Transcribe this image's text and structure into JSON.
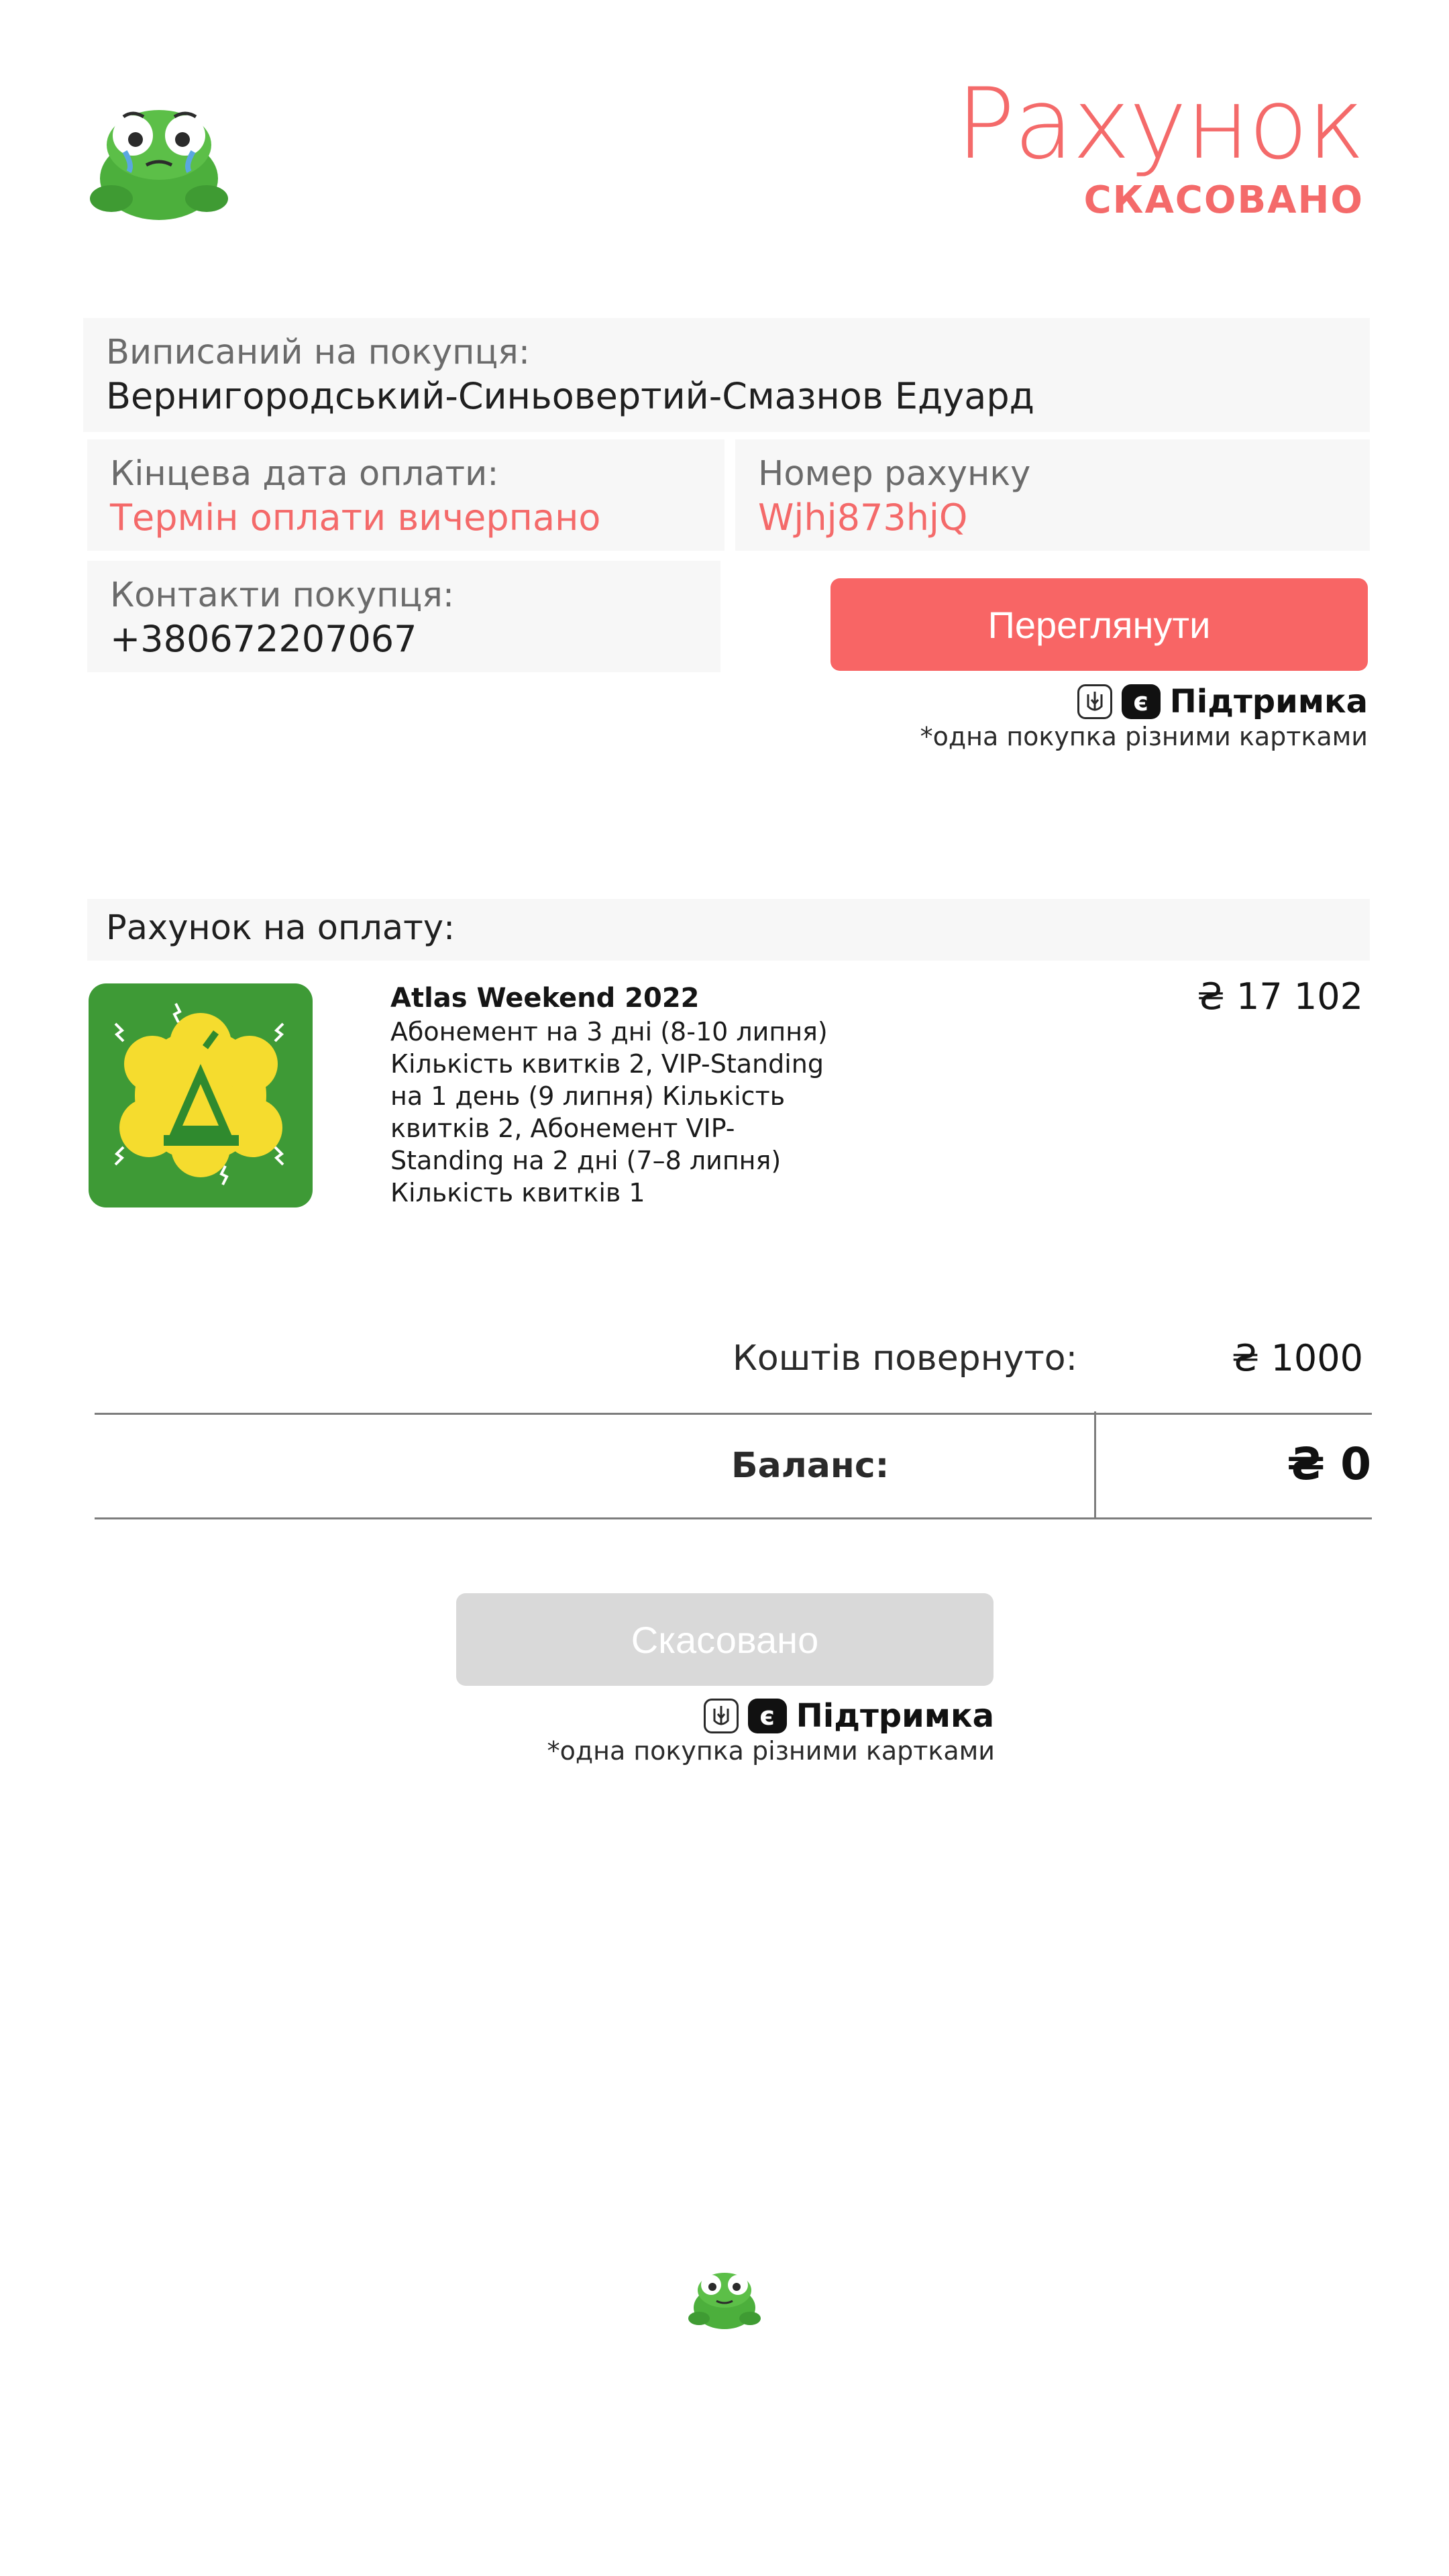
{
  "header": {
    "title": "Рахунок",
    "status": "СКАСОВАНО"
  },
  "info": {
    "buyer_label": "Виписаний на покупця:",
    "buyer_value": "Вернигородський-Синьовертий-Смазнов Едуард",
    "due_label": "Кінцева дата оплати:",
    "due_value": "Термін оплати вичерпано",
    "number_label": "Номер рахунку",
    "number_value": "Wjhj873hjQ",
    "contact_label": "Контакти покупця:",
    "contact_value": "+380672207067"
  },
  "actions": {
    "view_label": "Переглянути",
    "cancel_label": "Скасовано",
    "support_label": "Підтримка",
    "support_note": "*одна покупка різними картками"
  },
  "invoice": {
    "section_title": "Рахунок на оплату:",
    "product_title": "Atlas Weekend 2022",
    "product_desc": "Абонемент на 3 дні (8-10 липня) Кількість квитків 2, VIP-Standing на 1 день (9 липня) Кількість квитків 2, Абонемент VIP-Standing на 2 дні (7–8 липня) Кількість квитків 1",
    "price": "₴ 17 102",
    "refund_label": "Коштів повернуто:",
    "refund_value": "₴ 1000",
    "balance_label": "Баланс:",
    "balance_value": "₴ 0"
  },
  "icons": {
    "logo": "frog-logo-icon",
    "product": "atlas-weekend-icon",
    "tryzub": "tryzub-icon",
    "e": "e-icon"
  },
  "colors": {
    "accent": "#f46a6a",
    "button": "#f86565",
    "disabled": "#d9d9d9",
    "card": "#f7f7f7"
  }
}
